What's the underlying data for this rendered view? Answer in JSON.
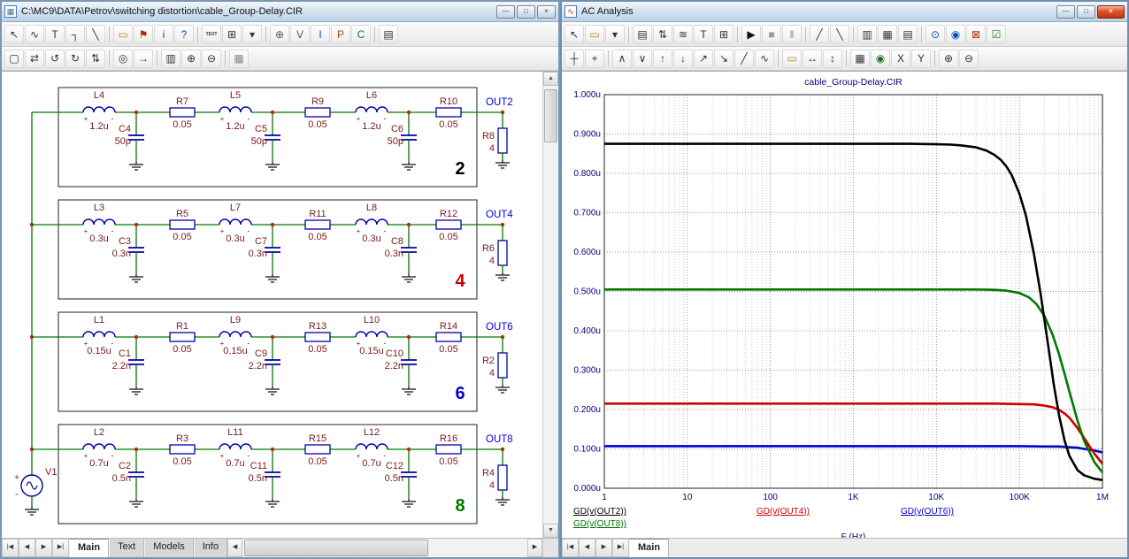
{
  "left_window": {
    "title": "C:\\MC9\\DATA\\Petrov\\switching distortion\\cable_Group-Delay.CIR",
    "icon": "▦",
    "icon_color": "#3a6ea5",
    "window_buttons": [
      {
        "name": "minimize",
        "glyph": "—"
      },
      {
        "name": "maximize",
        "glyph": "□"
      },
      {
        "name": "close",
        "glyph": "×"
      }
    ],
    "nav_buttons": [
      "|◀",
      "◀",
      "▶",
      "▶|"
    ],
    "tabs": [
      "Main",
      "Text",
      "Models",
      "Info"
    ],
    "active_tab": "Main",
    "toolbar1": [
      {
        "n": "select-mode",
        "g": "↖"
      },
      {
        "n": "component-mode",
        "g": "∿"
      },
      {
        "n": "text-mode",
        "g": "T"
      },
      {
        "n": "wire-mode",
        "g": "┐"
      },
      {
        "n": "diagonal-wire-mode",
        "g": "╲"
      },
      {
        "sep": true
      },
      {
        "n": "graphics-mode",
        "g": "▭",
        "c": "#b8860b"
      },
      {
        "n": "flag-mode",
        "g": "⚑",
        "c": "#bb2200"
      },
      {
        "n": "info-mode",
        "g": "i",
        "c": "#0050c0"
      },
      {
        "n": "help-mode",
        "g": "?",
        "c": "#0050c0"
      },
      {
        "sep": true
      },
      {
        "n": "grid-text-toggle",
        "g": "TEXT",
        "tiny": true
      },
      {
        "n": "attribute-text-toggle",
        "g": "⊞"
      },
      {
        "n": "display-options-dropdown",
        "g": "▾"
      },
      {
        "sep": true
      },
      {
        "n": "node-numbers-toggle",
        "g": "⊕",
        "c": "#555555"
      },
      {
        "n": "node-voltages-toggle",
        "g": "V",
        "c": "#555555"
      },
      {
        "n": "currents-toggle",
        "g": "I",
        "c": "#0050c0"
      },
      {
        "n": "powers-toggle",
        "g": "P",
        "c": "#a05000"
      },
      {
        "n": "conditions-toggle",
        "g": "C",
        "c": "#207020"
      },
      {
        "sep": true
      },
      {
        "n": "properties",
        "g": "▤"
      }
    ],
    "toolbar2": [
      {
        "n": "select-region",
        "g": "▢"
      },
      {
        "n": "flip-horizontal",
        "g": "⇄"
      },
      {
        "n": "rotate-ccw",
        "g": "↺"
      },
      {
        "n": "rotate-cw",
        "g": "↻"
      },
      {
        "n": "flip-vertical",
        "g": "⇅"
      },
      {
        "sep": true
      },
      {
        "n": "find",
        "g": "◎"
      },
      {
        "n": "find-next",
        "g": "→"
      },
      {
        "sep": true
      },
      {
        "n": "info-page",
        "g": "▥"
      },
      {
        "n": "zoom-in",
        "g": "⊕"
      },
      {
        "n": "zoom-out",
        "g": "⊖"
      },
      {
        "sep": true
      },
      {
        "n": "page-thumbnail",
        "g": "▦",
        "c": "#888888"
      }
    ]
  },
  "right_window": {
    "title": "AC Analysis",
    "icon": "∿",
    "icon_color": "#bb2200",
    "window_buttons": [
      {
        "name": "minimize",
        "glyph": "—"
      },
      {
        "name": "maximize",
        "glyph": "□"
      },
      {
        "name": "close",
        "glyph": "×",
        "style": "red"
      }
    ],
    "nav_buttons": [
      "|◀",
      "◀",
      "▶",
      "▶|"
    ],
    "tabs": [
      "Main"
    ],
    "active_tab": "Main",
    "toolbar1": [
      {
        "n": "select-mode",
        "g": "↖"
      },
      {
        "n": "graphics-mode",
        "g": "▭",
        "c": "#b8860b"
      },
      {
        "n": "graphics-dropdown",
        "g": "▾"
      },
      {
        "sep": true
      },
      {
        "n": "analysis-limits",
        "g": "▤"
      },
      {
        "n": "stepping",
        "g": "⇅"
      },
      {
        "n": "waveform-buffer",
        "g": "≋"
      },
      {
        "n": "text-mode",
        "g": "T"
      },
      {
        "n": "state-variables",
        "g": "⊞"
      },
      {
        "sep": true
      },
      {
        "n": "run",
        "g": "▶",
        "c": "#111111"
      },
      {
        "n": "stop",
        "g": "■",
        "c": "#999999"
      },
      {
        "n": "pause",
        "g": "‖",
        "c": "#888888"
      },
      {
        "sep": true
      },
      {
        "n": "cursor-line",
        "g": "╱"
      },
      {
        "n": "tangent-line",
        "g": "╲"
      },
      {
        "sep": true
      },
      {
        "n": "numeric-output",
        "g": "▥"
      },
      {
        "n": "data-points",
        "g": "▦"
      },
      {
        "n": "ruler",
        "g": "▤"
      },
      {
        "sep": true
      },
      {
        "n": "probe-one",
        "g": "⊙",
        "c": "#0050c0"
      },
      {
        "n": "probe-all",
        "g": "◉",
        "c": "#0050c0"
      },
      {
        "n": "exit-analysis",
        "g": "⊠",
        "c": "#bb2200"
      },
      {
        "n": "watch-list",
        "g": "☑",
        "c": "#207020"
      }
    ],
    "toolbar2": [
      {
        "n": "cursor-mode",
        "g": "┼"
      },
      {
        "n": "cursor-both",
        "g": "+"
      },
      {
        "sep": true
      },
      {
        "n": "next-peak",
        "g": "∧"
      },
      {
        "n": "next-valley",
        "g": "∨"
      },
      {
        "n": "next-high",
        "g": "↑"
      },
      {
        "n": "next-low",
        "g": "↓"
      },
      {
        "n": "rising-edge",
        "g": "↗"
      },
      {
        "n": "falling-edge",
        "g": "↘"
      },
      {
        "n": "slope",
        "g": "╱"
      },
      {
        "n": "inflection-point",
        "g": "∿"
      },
      {
        "sep": true
      },
      {
        "n": "tag-value",
        "g": "▭",
        "c": "#b8860b"
      },
      {
        "n": "tag-horizontal",
        "g": "↔"
      },
      {
        "n": "tag-vertical",
        "g": "↕"
      },
      {
        "sep": true
      },
      {
        "n": "align-cursors",
        "g": "▦"
      },
      {
        "n": "normalize",
        "g": "◉",
        "c": "#207020"
      },
      {
        "n": "go-to-x",
        "g": "X"
      },
      {
        "n": "go-to-y",
        "g": "Y"
      },
      {
        "sep": true
      },
      {
        "n": "zoom-in",
        "g": "⊕"
      },
      {
        "n": "zoom-out",
        "g": "⊖"
      }
    ]
  },
  "schematic": {
    "colors": {
      "wire": "#007a00",
      "component": "#0000a8",
      "text": "#7a1a1a",
      "node": "#0000e0",
      "dot": "#cc2200",
      "ground": "#1a1a1a",
      "box": "#202020"
    },
    "source": {
      "name": "V1"
    },
    "rows": [
      {
        "out": "OUT2",
        "number": "2",
        "number_color": "#000000",
        "L": [
          {
            "n": "L4",
            "v": "1.2u"
          },
          {
            "n": "L5",
            "v": "1.2u"
          },
          {
            "n": "L6",
            "v": "1.2u"
          }
        ],
        "C": [
          {
            "n": "C4",
            "v": "50p"
          },
          {
            "n": "C5",
            "v": "50p"
          },
          {
            "n": "C6",
            "v": "50p"
          }
        ],
        "R": [
          {
            "n": "R7",
            "v": "0.05"
          },
          {
            "n": "R9",
            "v": "0.05"
          },
          {
            "n": "R10",
            "v": "0.05"
          }
        ],
        "load": {
          "n": "R8",
          "v": "4"
        }
      },
      {
        "out": "OUT4",
        "number": "4",
        "number_color": "#cc0000",
        "L": [
          {
            "n": "L3",
            "v": "0.3u"
          },
          {
            "n": "L7",
            "v": "0.3u"
          },
          {
            "n": "L8",
            "v": "0.3u"
          }
        ],
        "C": [
          {
            "n": "C3",
            "v": "0.3n"
          },
          {
            "n": "C7",
            "v": "0.3n"
          },
          {
            "n": "C8",
            "v": "0.3n"
          }
        ],
        "R": [
          {
            "n": "R5",
            "v": "0.05"
          },
          {
            "n": "R11",
            "v": "0.05"
          },
          {
            "n": "R12",
            "v": "0.05"
          }
        ],
        "load": {
          "n": "R6",
          "v": "4"
        }
      },
      {
        "out": "OUT6",
        "number": "6",
        "number_color": "#0000cc",
        "L": [
          {
            "n": "L1",
            "v": "0.15u"
          },
          {
            "n": "L9",
            "v": "0.15u"
          },
          {
            "n": "L10",
            "v": "0.15u"
          }
        ],
        "C": [
          {
            "n": "C1",
            "v": "2.2n"
          },
          {
            "n": "C9",
            "v": "2.2n"
          },
          {
            "n": "C10",
            "v": "2.2n"
          }
        ],
        "R": [
          {
            "n": "R1",
            "v": "0.05"
          },
          {
            "n": "R13",
            "v": "0.05"
          },
          {
            "n": "R14",
            "v": "0.05"
          }
        ],
        "load": {
          "n": "R2",
          "v": "4"
        }
      },
      {
        "out": "OUT8",
        "number": "8",
        "number_color": "#007700",
        "L": [
          {
            "n": "L2",
            "v": "0.7u"
          },
          {
            "n": "L11",
            "v": "0.7u"
          },
          {
            "n": "L12",
            "v": "0.7u"
          }
        ],
        "C": [
          {
            "n": "C2",
            "v": "0.5n"
          },
          {
            "n": "C11",
            "v": "0.5n"
          },
          {
            "n": "C12",
            "v": "0.5n"
          }
        ],
        "R": [
          {
            "n": "R3",
            "v": "0.05"
          },
          {
            "n": "R15",
            "v": "0.05"
          },
          {
            "n": "R16",
            "v": "0.05"
          }
        ],
        "load": {
          "n": "R4",
          "v": "4"
        }
      }
    ]
  },
  "chart_data": {
    "type": "line",
    "title": "cable_Group-Delay.CIR",
    "xlabel": "F (Hz)",
    "ylabel": "",
    "x_scale": "log",
    "xlim": [
      1,
      1000000
    ],
    "ylim": [
      0,
      1
    ],
    "y_unit": "u",
    "grid": true,
    "legend_position": "below",
    "axis_color": "#00007d",
    "title_color": "#00007d",
    "x_ticks": [
      "1",
      "10",
      "100",
      "1K",
      "10K",
      "100K",
      "1M"
    ],
    "y_ticks": [
      "1.000u",
      "0.900u",
      "0.800u",
      "0.700u",
      "0.600u",
      "0.500u",
      "0.400u",
      "0.300u",
      "0.200u",
      "0.100u",
      "0.000u"
    ],
    "series": [
      {
        "id": "out6",
        "name": "GD(v(OUT6))",
        "color": "#0000cc",
        "x": [
          1,
          10,
          100,
          1000,
          10000,
          100000,
          200000,
          300000,
          400000,
          500000,
          600000,
          800000,
          1000000
        ],
        "y": [
          0.107,
          0.107,
          0.107,
          0.107,
          0.107,
          0.107,
          0.106,
          0.106,
          0.104,
          0.103,
          0.1,
          0.096,
          0.091
        ]
      },
      {
        "id": "out4",
        "name": "GD(v(OUT4))",
        "color": "#cc0000",
        "x": [
          1,
          10,
          100,
          1000,
          10000,
          50000,
          100000,
          150000,
          200000,
          250000,
          300000,
          350000,
          400000,
          500000,
          600000,
          700000,
          800000,
          1000000
        ],
        "y": [
          0.215,
          0.215,
          0.215,
          0.215,
          0.215,
          0.215,
          0.214,
          0.213,
          0.21,
          0.206,
          0.199,
          0.19,
          0.179,
          0.153,
          0.128,
          0.106,
          0.088,
          0.062
        ]
      },
      {
        "id": "out8",
        "name": "GD(v(OUT8))",
        "color": "#007700",
        "x": [
          1,
          10,
          100,
          1000,
          10000,
          30000,
          50000,
          70000,
          100000,
          130000,
          160000,
          200000,
          250000,
          300000,
          350000,
          400000,
          500000,
          600000,
          800000,
          1000000
        ],
        "y": [
          0.505,
          0.505,
          0.505,
          0.505,
          0.505,
          0.505,
          0.504,
          0.502,
          0.496,
          0.485,
          0.468,
          0.438,
          0.391,
          0.341,
          0.291,
          0.245,
          0.172,
          0.121,
          0.066,
          0.04
        ]
      },
      {
        "id": "out2",
        "name": "GD(v(OUT2))",
        "color": "#000000",
        "x": [
          1,
          10,
          100,
          1000,
          5000,
          10000,
          15000,
          20000,
          30000,
          40000,
          50000,
          60000,
          70000,
          80000,
          100000,
          120000,
          150000,
          180000,
          220000,
          260000,
          300000,
          350000,
          400000,
          500000,
          600000,
          800000,
          1000000
        ],
        "y": [
          0.875,
          0.875,
          0.875,
          0.875,
          0.875,
          0.874,
          0.873,
          0.871,
          0.866,
          0.858,
          0.847,
          0.834,
          0.817,
          0.797,
          0.748,
          0.692,
          0.594,
          0.494,
          0.368,
          0.262,
          0.186,
          0.121,
          0.082,
          0.046,
          0.033,
          0.024,
          0.021
        ]
      }
    ],
    "legend": [
      {
        "label": "GD(v(OUT2))",
        "color": "#000000",
        "row": 0,
        "xf": 0.02
      },
      {
        "label": "GD(v(OUT4))",
        "color": "#cc0000",
        "row": 0,
        "xf": 0.345
      },
      {
        "label": "GD(v(OUT6))",
        "color": "#0000cc",
        "row": 0,
        "xf": 0.6
      },
      {
        "label": "GD(v(OUT8))",
        "color": "#007700",
        "row": 1,
        "xf": 0.02
      }
    ]
  }
}
